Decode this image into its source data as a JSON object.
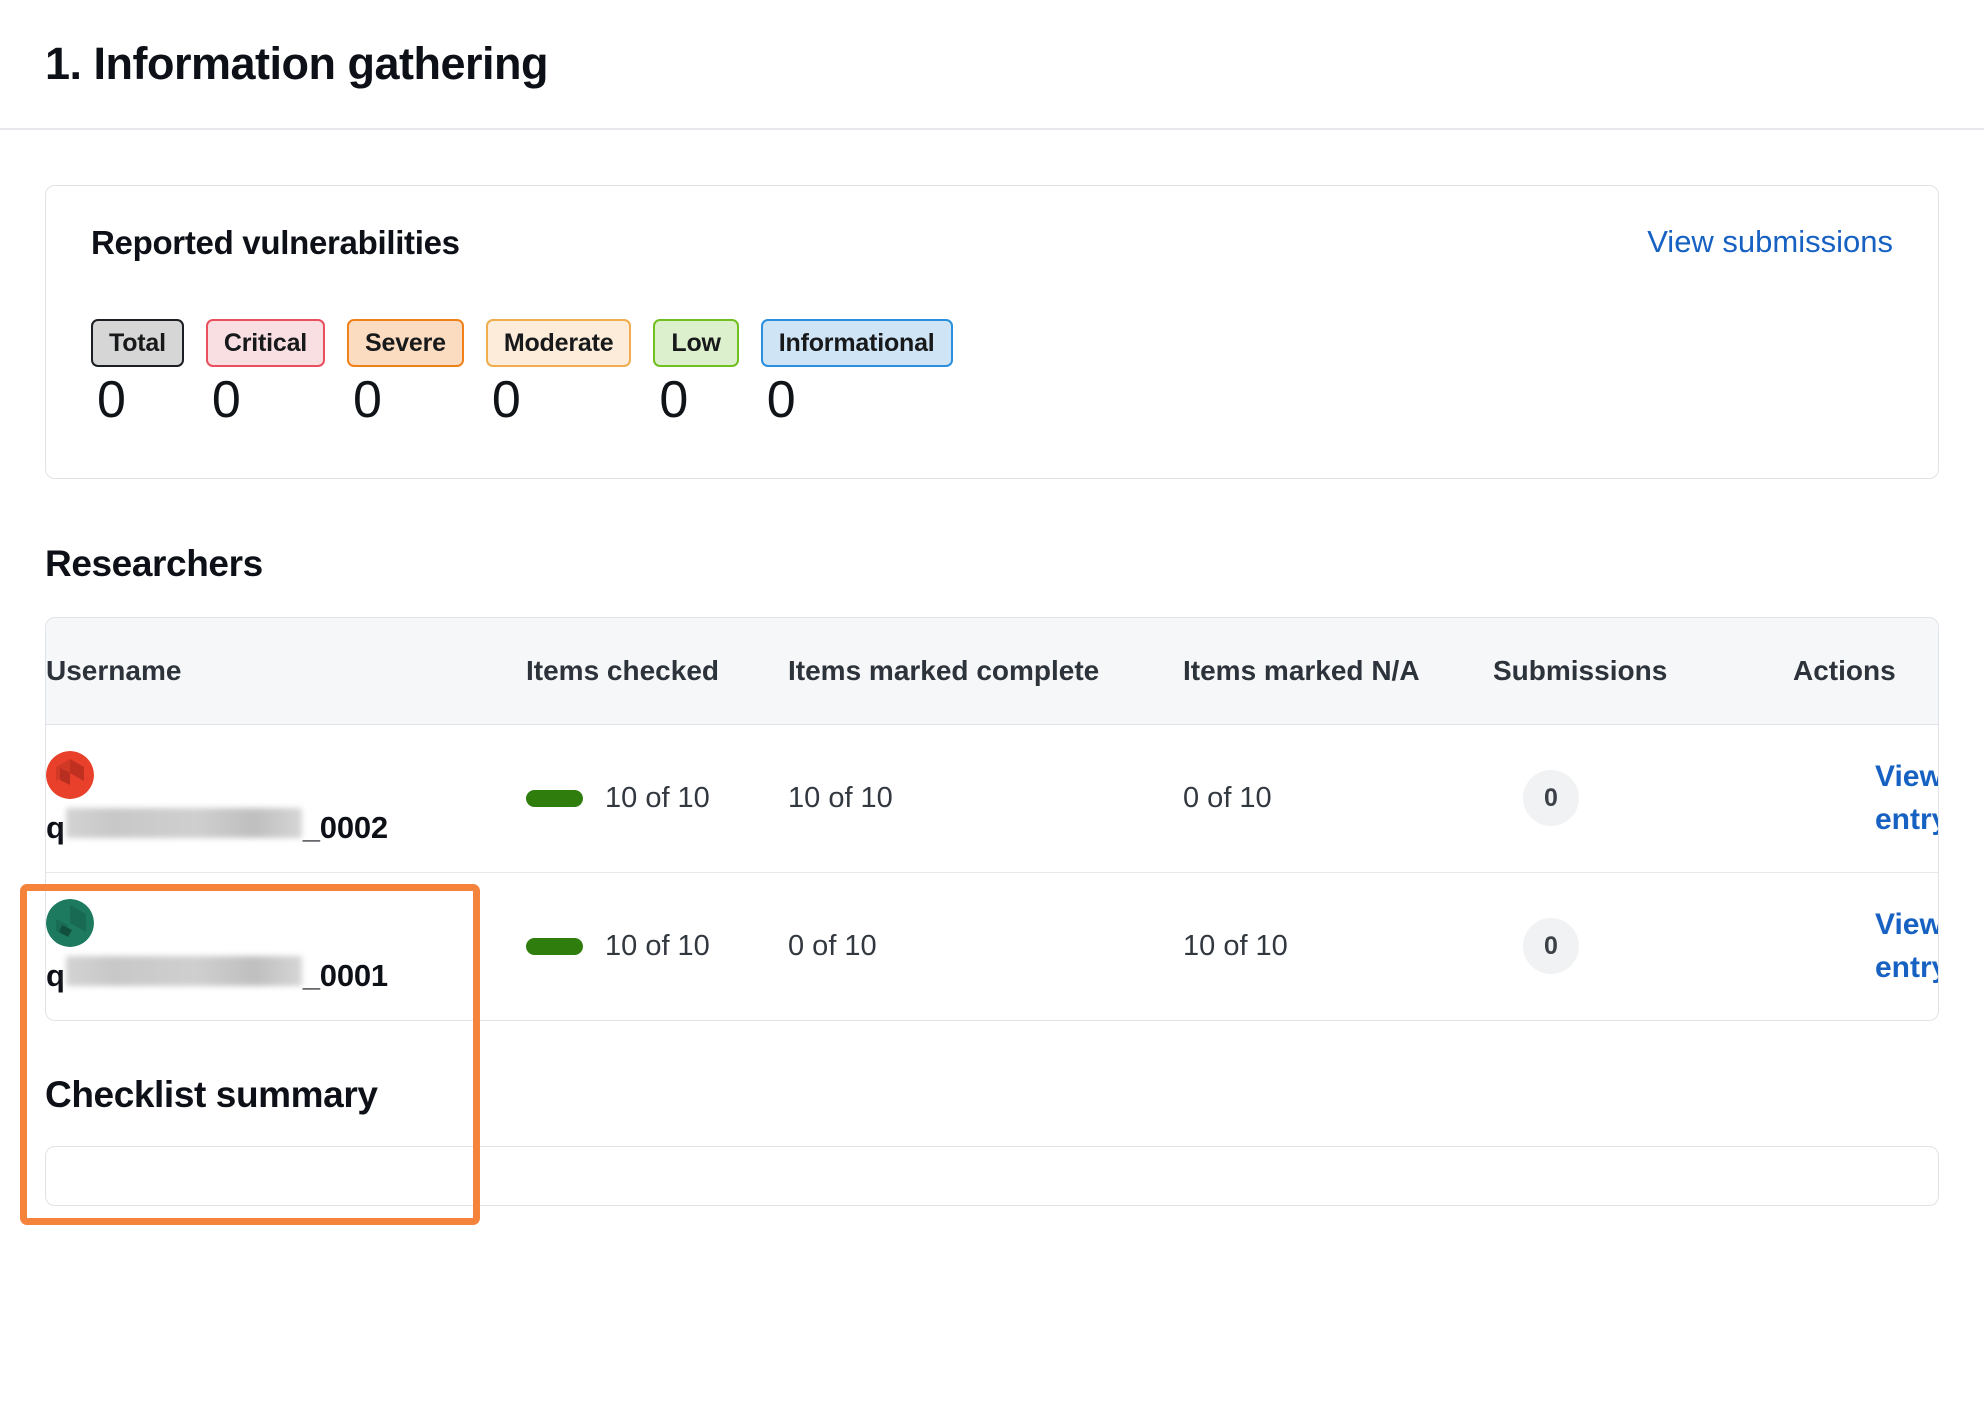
{
  "header": {
    "title": "1. Information gathering"
  },
  "vulnerabilities": {
    "title": "Reported vulnerabilities",
    "view_submissions_label": "View submissions",
    "severities": [
      {
        "label": "Total",
        "count": "0",
        "bg": "#d6d6d6",
        "border": "#1b1f23"
      },
      {
        "label": "Critical",
        "count": "0",
        "bg": "#f9dfe1",
        "border": "#e8505e"
      },
      {
        "label": "Severe",
        "count": "0",
        "bg": "#fcdcc0",
        "border": "#f0801a"
      },
      {
        "label": "Moderate",
        "count": "0",
        "bg": "#fdecd9",
        "border": "#f0ad4e"
      },
      {
        "label": "Low",
        "count": "0",
        "bg": "#ddf0cd",
        "border": "#71c021"
      },
      {
        "label": "Informational",
        "count": "0",
        "bg": "#cfe4f5",
        "border": "#2a8fdd"
      }
    ]
  },
  "researchers": {
    "section_title": "Researchers",
    "columns": {
      "username": "Username",
      "items_checked": "Items checked",
      "items_marked_complete": "Items marked complete",
      "items_marked_na": "Items marked N/A",
      "submissions": "Submissions",
      "actions": "Actions"
    },
    "rows": [
      {
        "username_prefix": "q",
        "username_suffix": "_0002",
        "avatar_color": "#e8402a",
        "avatar_accent": "#b82e20",
        "items_checked": "10 of 10",
        "items_marked_complete": "10 of 10",
        "items_marked_na": "0 of 10",
        "submissions": "0",
        "action_label": "View entry"
      },
      {
        "username_prefix": "q",
        "username_suffix": "_0001",
        "avatar_color": "#1d7a5f",
        "avatar_accent": "#12503e",
        "items_checked": "10 of 10",
        "items_marked_complete": "0 of 10",
        "items_marked_na": "10 of 10",
        "submissions": "0",
        "action_label": "View entry"
      }
    ]
  },
  "checklist": {
    "title": "Checklist summary"
  },
  "colors": {
    "link_blue": "#1661c2",
    "highlight_orange": "#f5833c",
    "progress_green": "#2f7d0d"
  }
}
